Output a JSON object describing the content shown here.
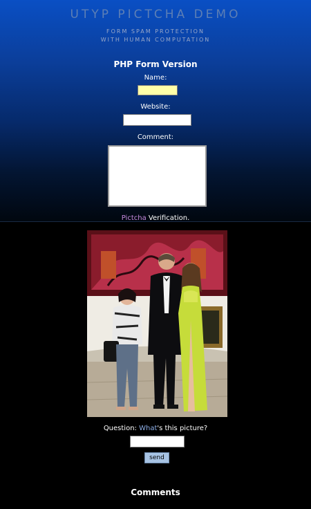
{
  "header": {
    "title": "UTYP PICTCHA DEMO",
    "subtitle_line1": "FORM SPAM PROTECTION",
    "subtitle_line2": "WITH HUMAN COMPUTATION"
  },
  "form": {
    "title": "PHP Form Version",
    "name_label": "Name:",
    "name_value": "",
    "website_label": "Website:",
    "website_value": "",
    "comment_label": "Comment:",
    "comment_value": ""
  },
  "verification": {
    "pictcha_word": "Pictcha",
    "verification_word": " Verification."
  },
  "question": {
    "prefix": "Question: ",
    "what_word": "What",
    "suffix": "'s this picture?",
    "answer_value": ""
  },
  "buttons": {
    "send_label": "send"
  },
  "comments": {
    "title": "Comments"
  },
  "colors": {
    "name_field_bg": "#ffffa8",
    "pictcha_link": "#c88be0",
    "what_link": "#8fb0e8",
    "send_button_bg": "#a7c3e3"
  }
}
